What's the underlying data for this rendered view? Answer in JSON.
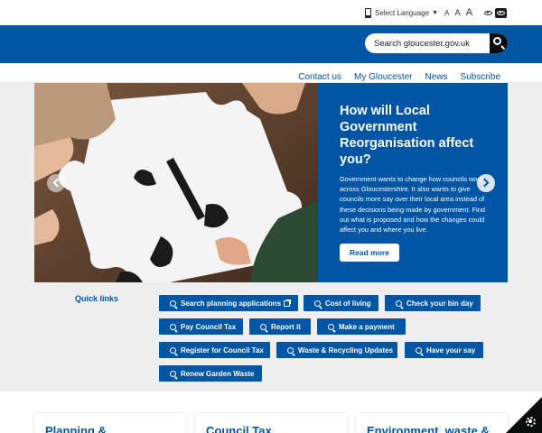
{
  "utility": {
    "language_label": "Select Language",
    "text_sizes": [
      "A",
      "A",
      "A"
    ]
  },
  "header": {
    "search_placeholder": "Search gloucester.gov.uk"
  },
  "nav": {
    "items": [
      "Contact us",
      "My Gloucester",
      "News",
      "Subscribe"
    ]
  },
  "hero": {
    "title": "How will Local Government Reorganisation affect you?",
    "body": "Government wants to change how councils work across Gloucestershire. It also wants to give councils more say over their local area instead of these decisions being made by government. Find out what is proposed and how the changes could affect you and where you live.",
    "cta": "Read more"
  },
  "quick_links": {
    "title": "Quick links",
    "buttons": [
      "Search planning applications",
      "Cost of living",
      "Check your bin day",
      "Pay Council Tax",
      "Report it",
      "Make a payment",
      "Register for Council Tax",
      "Waste & Recycling Updates",
      "Have your say",
      "Renew Garden Waste"
    ]
  },
  "cards": [
    "Planning &",
    "Council Tax",
    "Environment, waste &"
  ],
  "colors": {
    "brand_blue": "#0055a5",
    "dark": "#0b0c0c",
    "background_grey": "#eeeeee"
  }
}
